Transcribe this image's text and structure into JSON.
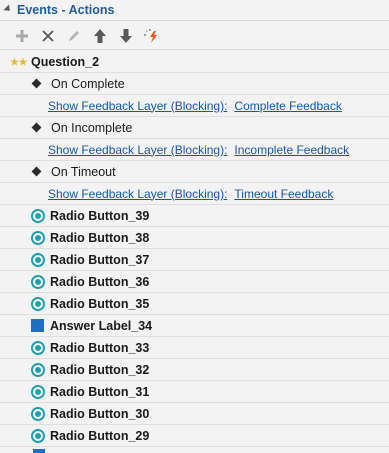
{
  "panel": {
    "title": "Events - Actions"
  },
  "toolbar": [
    {
      "name": "add-icon"
    },
    {
      "name": "delete-icon"
    },
    {
      "name": "edit-icon"
    },
    {
      "name": "move-up-icon"
    },
    {
      "name": "move-down-icon"
    },
    {
      "name": "magic-wand-icon"
    }
  ],
  "question": {
    "label": "Question_2"
  },
  "events": [
    {
      "label": "On Complete",
      "action_prefix": "Show Feedback Layer (Blocking):",
      "action_target": "Complete Feedback"
    },
    {
      "label": "On Incomplete",
      "action_prefix": "Show Feedback Layer (Blocking):",
      "action_target": "Incomplete Feedback"
    },
    {
      "label": "On Timeout",
      "action_prefix": "Show Feedback Layer (Blocking):",
      "action_target": "Timeout Feedback"
    }
  ],
  "objects": [
    {
      "label": "Radio Button_39",
      "icon": "radio-button-icon"
    },
    {
      "label": "Radio Button_38",
      "icon": "radio-button-icon"
    },
    {
      "label": "Radio Button_37",
      "icon": "radio-button-icon"
    },
    {
      "label": "Radio Button_36",
      "icon": "radio-button-icon"
    },
    {
      "label": "Radio Button_35",
      "icon": "radio-button-icon"
    },
    {
      "label": "Answer Label_34",
      "icon": "answer-label-icon"
    },
    {
      "label": "Radio Button_33",
      "icon": "radio-button-icon"
    },
    {
      "label": "Radio Button_32",
      "icon": "radio-button-icon"
    },
    {
      "label": "Radio Button_31",
      "icon": "radio-button-icon"
    },
    {
      "label": "Radio Button_30",
      "icon": "radio-button-icon"
    },
    {
      "label": "Radio Button_29",
      "icon": "radio-button-icon"
    }
  ],
  "colors": {
    "accent": "#1f5fa0",
    "link": "#1457a6",
    "radio": "#1ea0b0",
    "label_square": "#1e6fc0"
  }
}
